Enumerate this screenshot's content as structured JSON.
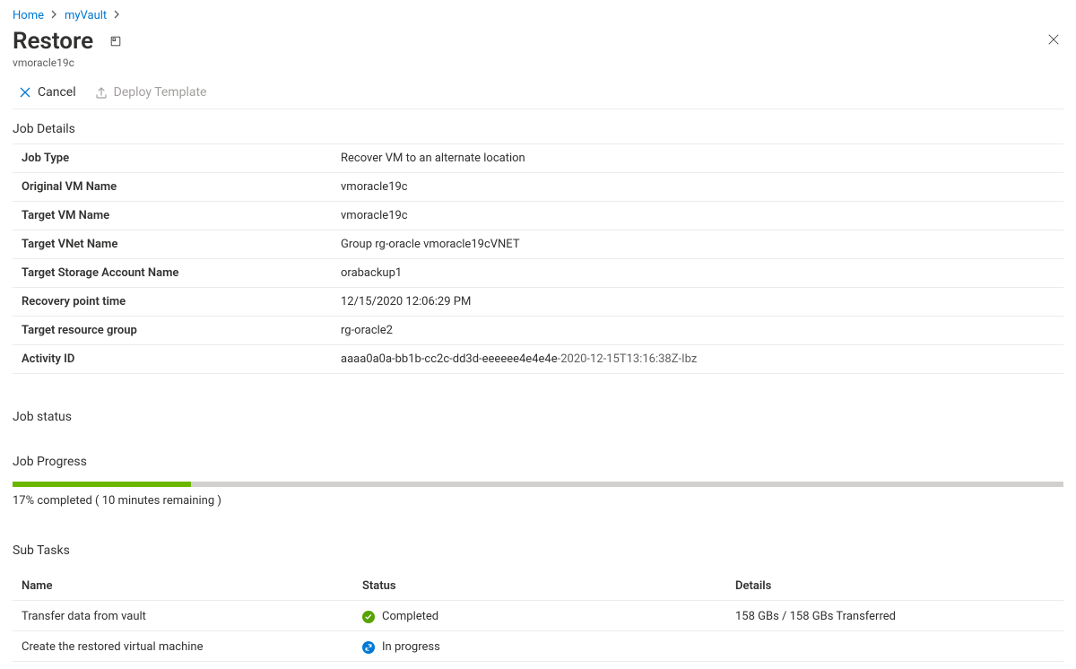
{
  "breadcrumb": {
    "home": "Home",
    "vault": "myVault"
  },
  "header": {
    "title": "Restore",
    "subtitle": "vmoracle19c"
  },
  "toolbar": {
    "cancel_label": "Cancel",
    "deploy_label": "Deploy Template"
  },
  "sections": {
    "job_details": "Job Details",
    "job_status": "Job status",
    "job_progress": "Job Progress",
    "sub_tasks": "Sub Tasks"
  },
  "details": {
    "rows": [
      {
        "label": "Job Type",
        "value": "Recover VM to an alternate location"
      },
      {
        "label": "Original VM Name",
        "value": "vmoracle19c"
      },
      {
        "label": "Target VM Name",
        "value": "vmoracle19c"
      },
      {
        "label": "Target VNet Name",
        "value": "Group rg-oracle vmoracle19cVNET"
      },
      {
        "label": "Target Storage Account Name",
        "value": "orabackup1"
      },
      {
        "label": "Recovery point time",
        "value": "12/15/2020 12:06:29 PM"
      },
      {
        "label": "Target resource group",
        "value": "rg-oracle2"
      }
    ],
    "activity_label": "Activity ID",
    "activity_id_main": "aaaa0a0a-bb1b-cc2c-dd3d-eeeeee4e4e4e",
    "activity_id_suffix": "-2020-12-15T13:16:38Z-Ibz"
  },
  "progress": {
    "percent": 17,
    "text": "17% completed ( 10 minutes remaining )"
  },
  "subtasks": {
    "cols": {
      "name": "Name",
      "status": "Status",
      "details": "Details"
    },
    "rows": [
      {
        "name": "Transfer data from vault",
        "status": "Completed",
        "status_kind": "completed",
        "details": "158 GBs / 158 GBs Transferred"
      },
      {
        "name": "Create the restored virtual machine",
        "status": "In progress",
        "status_kind": "inprogress",
        "details": ""
      }
    ]
  }
}
